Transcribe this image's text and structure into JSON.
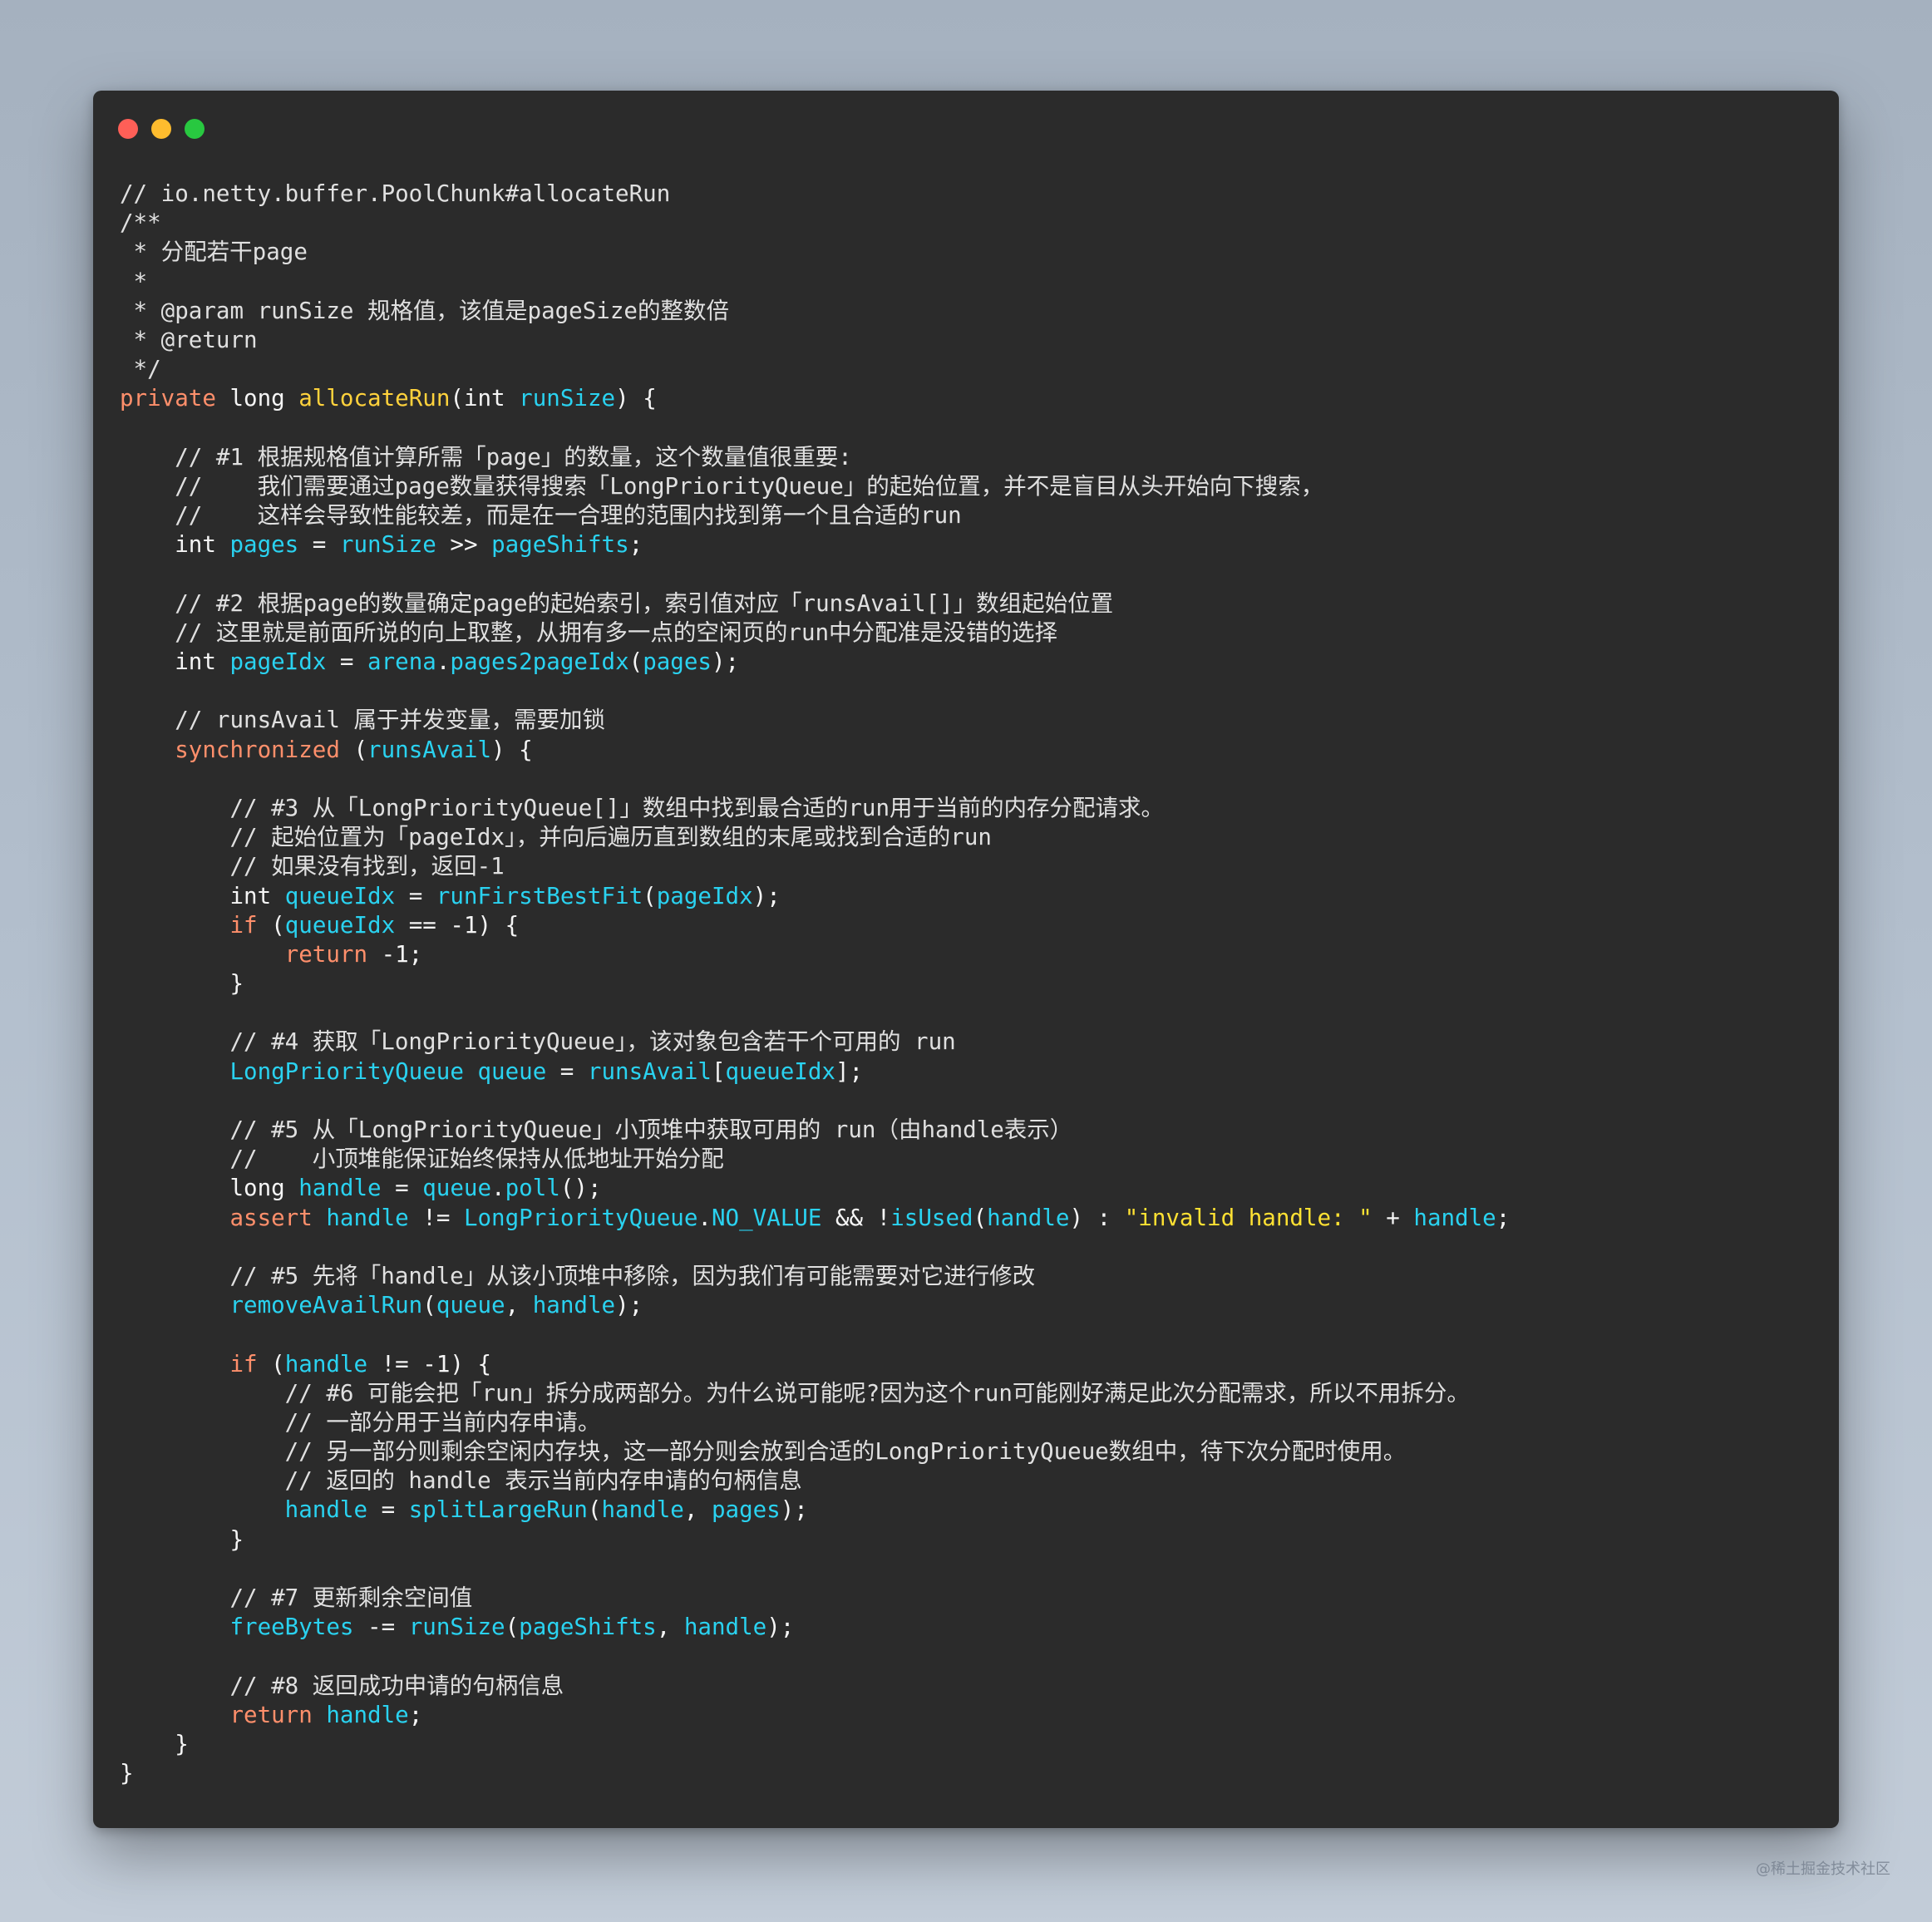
{
  "window": {
    "controls": [
      "close",
      "minimize",
      "zoom"
    ],
    "colors": {
      "close": "#ff5f57",
      "minimize": "#febc2e",
      "zoom": "#28c840",
      "background": "#2b2b2b"
    }
  },
  "code": {
    "language": "java",
    "lines": [
      [
        [
          "c",
          "// io.netty.buffer.PoolChunk#allocateRun"
        ]
      ],
      [
        [
          "c",
          "/**"
        ]
      ],
      [
        [
          "c",
          " * 分配若干page"
        ]
      ],
      [
        [
          "c",
          " *"
        ]
      ],
      [
        [
          "c",
          " * @param runSize 规格值，该值是pageSize的整数倍"
        ]
      ],
      [
        [
          "c",
          " * @return"
        ]
      ],
      [
        [
          "c",
          " */"
        ]
      ],
      [
        [
          "kw",
          "private"
        ],
        [
          "ty",
          " long "
        ],
        [
          "fn",
          "allocateRun"
        ],
        [
          "op",
          "("
        ],
        [
          "ty",
          "int "
        ],
        [
          "id",
          "runSize"
        ],
        [
          "op",
          ") {"
        ]
      ],
      [
        [
          "op",
          ""
        ]
      ],
      [
        [
          "c",
          "    // #1 根据规格值计算所需「page」的数量，这个数量值很重要:"
        ]
      ],
      [
        [
          "c",
          "    //    我们需要通过page数量获得搜索「LongPriorityQueue」的起始位置，并不是盲目从头开始向下搜索，"
        ]
      ],
      [
        [
          "c",
          "    //    这样会导致性能较差，而是在一合理的范围内找到第一个且合适的run"
        ]
      ],
      [
        [
          "ty",
          "    int "
        ],
        [
          "id",
          "pages"
        ],
        [
          "op",
          " = "
        ],
        [
          "id",
          "runSize"
        ],
        [
          "op",
          " >> "
        ],
        [
          "id",
          "pageShifts"
        ],
        [
          "op",
          ";"
        ]
      ],
      [
        [
          "op",
          ""
        ]
      ],
      [
        [
          "c",
          "    // #2 根据page的数量确定page的起始索引，索引值对应「runsAvail[]」数组起始位置"
        ]
      ],
      [
        [
          "c",
          "    // 这里就是前面所说的向上取整，从拥有多一点的空闲页的run中分配准是没错的选择"
        ]
      ],
      [
        [
          "ty",
          "    int "
        ],
        [
          "id",
          "pageIdx"
        ],
        [
          "op",
          " = "
        ],
        [
          "id",
          "arena"
        ],
        [
          "op",
          "."
        ],
        [
          "id",
          "pages2pageIdx"
        ],
        [
          "op",
          "("
        ],
        [
          "id",
          "pages"
        ],
        [
          "op",
          ");"
        ]
      ],
      [
        [
          "op",
          ""
        ]
      ],
      [
        [
          "c",
          "    // runsAvail 属于并发变量，需要加锁"
        ]
      ],
      [
        [
          "kw",
          "    synchronized"
        ],
        [
          "op",
          " ("
        ],
        [
          "id",
          "runsAvail"
        ],
        [
          "op",
          ") {"
        ]
      ],
      [
        [
          "op",
          ""
        ]
      ],
      [
        [
          "c",
          "        // #3 从「LongPriorityQueue[]」数组中找到最合适的run用于当前的内存分配请求。"
        ]
      ],
      [
        [
          "c",
          "        // 起始位置为「pageIdx」，并向后遍历直到数组的末尾或找到合适的run"
        ]
      ],
      [
        [
          "c",
          "        // 如果没有找到，返回-1"
        ]
      ],
      [
        [
          "ty",
          "        int "
        ],
        [
          "id",
          "queueIdx"
        ],
        [
          "op",
          " = "
        ],
        [
          "id",
          "runFirstBestFit"
        ],
        [
          "op",
          "("
        ],
        [
          "id",
          "pageIdx"
        ],
        [
          "op",
          ");"
        ]
      ],
      [
        [
          "kw",
          "        if"
        ],
        [
          "op",
          " ("
        ],
        [
          "id",
          "queueIdx"
        ],
        [
          "op",
          " == -1) {"
        ]
      ],
      [
        [
          "kw",
          "            return"
        ],
        [
          "op",
          " -1;"
        ]
      ],
      [
        [
          "op",
          "        }"
        ]
      ],
      [
        [
          "op",
          ""
        ]
      ],
      [
        [
          "c",
          "        // #4 获取「LongPriorityQueue」，该对象包含若干个可用的 run"
        ]
      ],
      [
        [
          "id",
          "        LongPriorityQueue queue"
        ],
        [
          "op",
          " = "
        ],
        [
          "id",
          "runsAvail"
        ],
        [
          "op",
          "["
        ],
        [
          "id",
          "queueIdx"
        ],
        [
          "op",
          "];"
        ]
      ],
      [
        [
          "op",
          ""
        ]
      ],
      [
        [
          "c",
          "        // #5 从「LongPriorityQueue」小顶堆中获取可用的 run（由handle表示）"
        ]
      ],
      [
        [
          "c",
          "        //    小顶堆能保证始终保持从低地址开始分配"
        ]
      ],
      [
        [
          "ty",
          "        long "
        ],
        [
          "id",
          "handle"
        ],
        [
          "op",
          " = "
        ],
        [
          "id",
          "queue"
        ],
        [
          "op",
          "."
        ],
        [
          "id",
          "poll"
        ],
        [
          "op",
          "();"
        ]
      ],
      [
        [
          "kw",
          "        assert"
        ],
        [
          "op",
          " "
        ],
        [
          "id",
          "handle"
        ],
        [
          "op",
          " != "
        ],
        [
          "id",
          "LongPriorityQueue"
        ],
        [
          "op",
          "."
        ],
        [
          "id",
          "NO_VALUE"
        ],
        [
          "op",
          " && !"
        ],
        [
          "id",
          "isUsed"
        ],
        [
          "op",
          "("
        ],
        [
          "id",
          "handle"
        ],
        [
          "op",
          ") : "
        ],
        [
          "st",
          "\"invalid handle: \""
        ],
        [
          "op",
          " + "
        ],
        [
          "id",
          "handle"
        ],
        [
          "op",
          ";"
        ]
      ],
      [
        [
          "op",
          ""
        ]
      ],
      [
        [
          "c",
          "        // #5 先将「handle」从该小顶堆中移除，因为我们有可能需要对它进行修改"
        ]
      ],
      [
        [
          "id",
          "        removeAvailRun"
        ],
        [
          "op",
          "("
        ],
        [
          "id",
          "queue"
        ],
        [
          "op",
          ", "
        ],
        [
          "id",
          "handle"
        ],
        [
          "op",
          ");"
        ]
      ],
      [
        [
          "op",
          ""
        ]
      ],
      [
        [
          "kw",
          "        if"
        ],
        [
          "op",
          " ("
        ],
        [
          "id",
          "handle"
        ],
        [
          "op",
          " != -1) {"
        ]
      ],
      [
        [
          "c",
          "            // #6 可能会把「run」拆分成两部分。为什么说可能呢?因为这个run可能刚好满足此次分配需求，所以不用拆分。"
        ]
      ],
      [
        [
          "c",
          "            // 一部分用于当前内存申请。"
        ]
      ],
      [
        [
          "c",
          "            // 另一部分则剩余空闲内存块，这一部分则会放到合适的LongPriorityQueue数组中，待下次分配时使用。"
        ]
      ],
      [
        [
          "c",
          "            // 返回的 handle 表示当前内存申请的句柄信息"
        ]
      ],
      [
        [
          "id",
          "            handle"
        ],
        [
          "op",
          " = "
        ],
        [
          "id",
          "splitLargeRun"
        ],
        [
          "op",
          "("
        ],
        [
          "id",
          "handle"
        ],
        [
          "op",
          ", "
        ],
        [
          "id",
          "pages"
        ],
        [
          "op",
          ");"
        ]
      ],
      [
        [
          "op",
          "        }"
        ]
      ],
      [
        [
          "op",
          ""
        ]
      ],
      [
        [
          "c",
          "        // #7 更新剩余空间值"
        ]
      ],
      [
        [
          "id",
          "        freeBytes"
        ],
        [
          "op",
          " -= "
        ],
        [
          "id",
          "runSize"
        ],
        [
          "op",
          "("
        ],
        [
          "id",
          "pageShifts"
        ],
        [
          "op",
          ", "
        ],
        [
          "id",
          "handle"
        ],
        [
          "op",
          ");"
        ]
      ],
      [
        [
          "op",
          ""
        ]
      ],
      [
        [
          "c",
          "        // #8 返回成功申请的句柄信息"
        ]
      ],
      [
        [
          "kw",
          "        return"
        ],
        [
          "op",
          " "
        ],
        [
          "id",
          "handle"
        ],
        [
          "op",
          ";"
        ]
      ],
      [
        [
          "op",
          "    }"
        ]
      ],
      [
        [
          "op",
          "}"
        ]
      ]
    ]
  },
  "watermark": "@稀土掘金技术社区"
}
